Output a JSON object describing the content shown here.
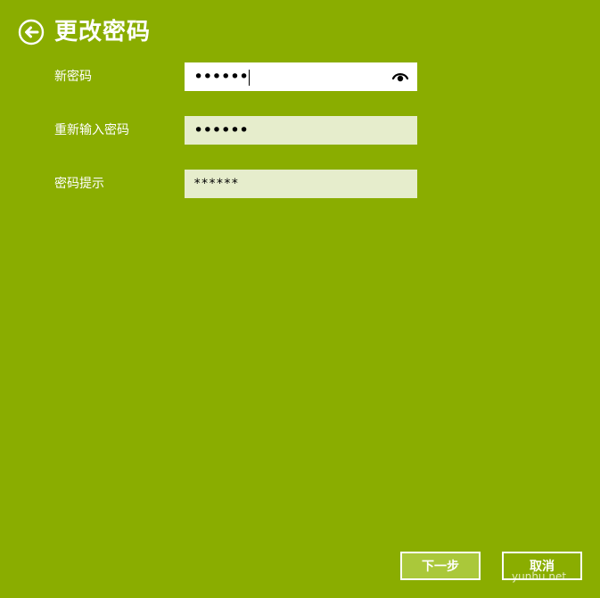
{
  "header": {
    "back_icon": "back-arrow-circle-icon",
    "title": "更改密码"
  },
  "form": {
    "new_password": {
      "label": "新密码",
      "value": "••••••",
      "reveal_icon": "eye-icon"
    },
    "confirm_password": {
      "label": "重新输入密码",
      "value": "••••••"
    },
    "password_hint": {
      "label": "密码提示",
      "value": "******"
    }
  },
  "buttons": {
    "next_label": "下一步",
    "cancel_label": "取消"
  },
  "watermark": "yunhu.net",
  "colors": {
    "background": "#8aad00",
    "field_inactive": "#e6edcc",
    "field_active": "#ffffff",
    "primary_button": "#aac83a"
  }
}
